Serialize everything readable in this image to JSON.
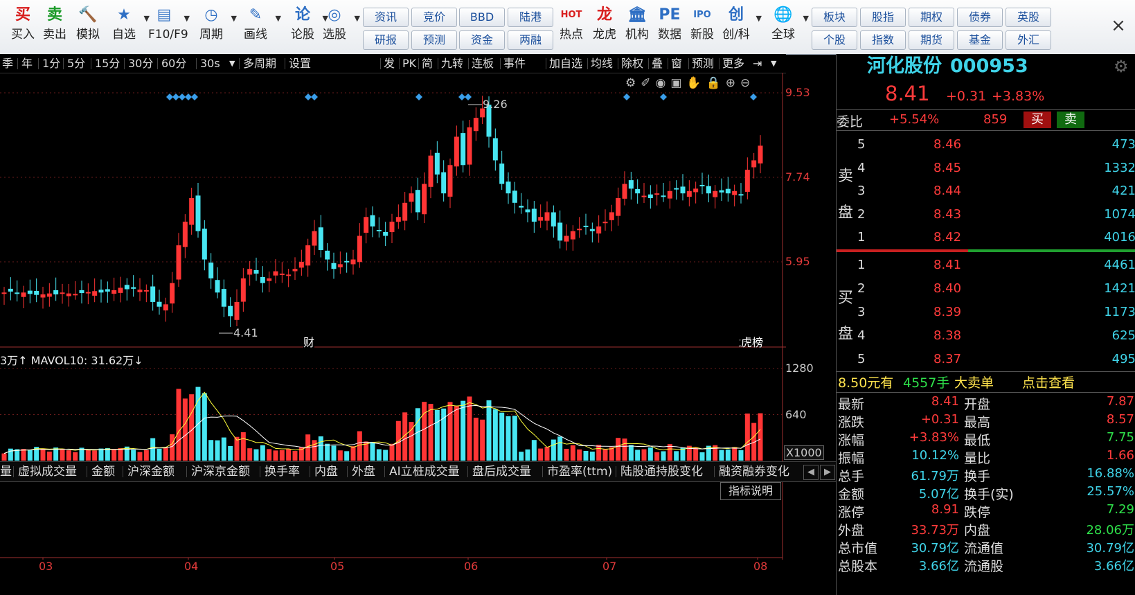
{
  "toolbar": {
    "tools": [
      {
        "icon": "买",
        "label": "买入",
        "name": "buy"
      },
      {
        "icon": "卖",
        "label": "卖出",
        "name": "sell"
      },
      {
        "icon": "🔨",
        "label": "模拟",
        "name": "simulate"
      },
      {
        "icon": "★",
        "label": "自选",
        "name": "watchlist"
      },
      {
        "icon": "▤",
        "label": "F10/F9",
        "name": "f10"
      },
      {
        "icon": "◷",
        "label": "周期",
        "name": "period"
      },
      {
        "icon": "✎",
        "label": "画线",
        "name": "draw-line"
      },
      {
        "icon": "论",
        "label": "论股",
        "name": "discuss"
      },
      {
        "icon": "◎",
        "label": "选股",
        "name": "stock-pick"
      }
    ],
    "buttons_row1": [
      "资讯",
      "竞价",
      "BBD",
      "陆港"
    ],
    "buttons_row2": [
      "研报",
      "预测",
      "资金",
      "两融"
    ],
    "tools2": [
      {
        "icon": "HOT",
        "label": "热点",
        "name": "hot"
      },
      {
        "icon": "龙",
        "label": "龙虎",
        "name": "dragon-tiger"
      },
      {
        "icon": "🏛",
        "label": "机构",
        "name": "institution"
      },
      {
        "icon": "PE",
        "label": "数据",
        "name": "data"
      },
      {
        "icon": "IPO",
        "label": "新股",
        "name": "new-stock"
      },
      {
        "icon": "创",
        "label": "创/科",
        "name": "gem"
      },
      {
        "icon": "🌐",
        "label": "全球",
        "name": "global"
      }
    ],
    "buttons2_row1": [
      "板块",
      "股指",
      "期权",
      "债券",
      "英股"
    ],
    "buttons2_row2": [
      "个股",
      "指数",
      "期货",
      "基金",
      "外汇"
    ]
  },
  "periodbar": {
    "items": [
      "季",
      "年",
      "1分",
      "5分",
      "15分",
      "30分",
      "60分",
      "30s",
      "多周期",
      "设置"
    ],
    "right_items": [
      "发",
      "PK",
      "简",
      "九转",
      "连板",
      "事件",
      "加自选",
      "均线",
      "除权",
      "叠",
      "窗",
      "预测",
      "更多"
    ]
  },
  "chart_data": {
    "type": "candlestick",
    "price_axis": {
      "ticks": [
        9.53,
        7.74,
        5.95
      ]
    },
    "volume_axis": {
      "ticks": [
        1280,
        640
      ],
      "unit": "X1000"
    },
    "x_labels": [
      "03",
      "04",
      "05",
      "06",
      "07",
      "08"
    ],
    "high_label": "9.26",
    "low_label": "4.41",
    "markers": [
      "财",
      "龙虎榜"
    ],
    "volume_legend": "3万↑ MAVOL10: 31.62万↓"
  },
  "tabs": [
    "量",
    "虚拟成交量",
    "金额",
    "沪深金额",
    "沪深京金额",
    "换手率",
    "内盘",
    "外盘",
    "AI立桩成交量",
    "盘后成交量",
    "市盈率(ttm)",
    "陆股通持股变化",
    "融资融券变化"
  ],
  "indicator_help": "指标说明",
  "stock": {
    "name": "河化股份",
    "code": "000953",
    "price": "8.41",
    "change": "+0.31",
    "pct": "+3.83%"
  },
  "order_book": {
    "weibi_label": "委比",
    "weibi": "+5.54%",
    "weicha": "859",
    "buy_btn": "买",
    "sell_btn": "卖",
    "sell_label_1": "卖",
    "sell_label_2": "盘",
    "buy_label_1": "买",
    "buy_label_2": "盘",
    "asks": [
      {
        "lvl": "5",
        "price": "8.46",
        "vol": "473"
      },
      {
        "lvl": "4",
        "price": "8.45",
        "vol": "1332"
      },
      {
        "lvl": "3",
        "price": "8.44",
        "vol": "421"
      },
      {
        "lvl": "2",
        "price": "8.43",
        "vol": "1074"
      },
      {
        "lvl": "1",
        "price": "8.42",
        "vol": "4016"
      }
    ],
    "bids": [
      {
        "lvl": "1",
        "price": "8.41",
        "vol": "4461"
      },
      {
        "lvl": "2",
        "price": "8.40",
        "vol": "1421"
      },
      {
        "lvl": "3",
        "price": "8.39",
        "vol": "1173"
      },
      {
        "lvl": "4",
        "price": "8.38",
        "vol": "625"
      },
      {
        "lvl": "5",
        "price": "8.37",
        "vol": "495"
      }
    ]
  },
  "big_order": {
    "price": "8.50元有",
    "qty": "4557手",
    "type": "大卖单",
    "action": "点击查看"
  },
  "quote": [
    {
      "l": "最新",
      "v": "8.41",
      "vc": "red",
      "l2": "开盘",
      "v2": "7.87",
      "v2c": "red"
    },
    {
      "l": "涨跌",
      "v": "+0.31",
      "vc": "red",
      "l2": "最高",
      "v2": "8.57",
      "v2c": "red"
    },
    {
      "l": "涨幅",
      "v": "+3.83%",
      "vc": "red",
      "l2": "最低",
      "v2": "7.75",
      "v2c": "green"
    },
    {
      "l": "振幅",
      "v": "10.12%",
      "vc": "cyan",
      "l2": "量比",
      "v2": "1.66",
      "v2c": "red"
    },
    {
      "l": "总手",
      "v": "61.79万",
      "vc": "cyan",
      "l2": "换手",
      "v2": "16.88%",
      "v2c": "cyan"
    },
    {
      "l": "金额",
      "v": "5.07亿",
      "vc": "cyan",
      "l2": "换手(实)",
      "v2": "25.57%",
      "v2c": "cyan"
    },
    {
      "l": "涨停",
      "v": "8.91",
      "vc": "red",
      "l2": "跌停",
      "v2": "7.29",
      "v2c": "green"
    },
    {
      "l": "外盘",
      "v": "33.73万",
      "vc": "red",
      "l2": "内盘",
      "v2": "28.06万",
      "v2c": "green"
    },
    {
      "l": "总市值",
      "v": "30.79亿",
      "vc": "cyan",
      "l2": "流通值",
      "v2": "30.79亿",
      "v2c": "cyan"
    },
    {
      "l": "总股本",
      "v": "3.66亿",
      "vc": "cyan",
      "l2": "流通股",
      "v2": "3.66亿",
      "v2c": "cyan"
    }
  ]
}
